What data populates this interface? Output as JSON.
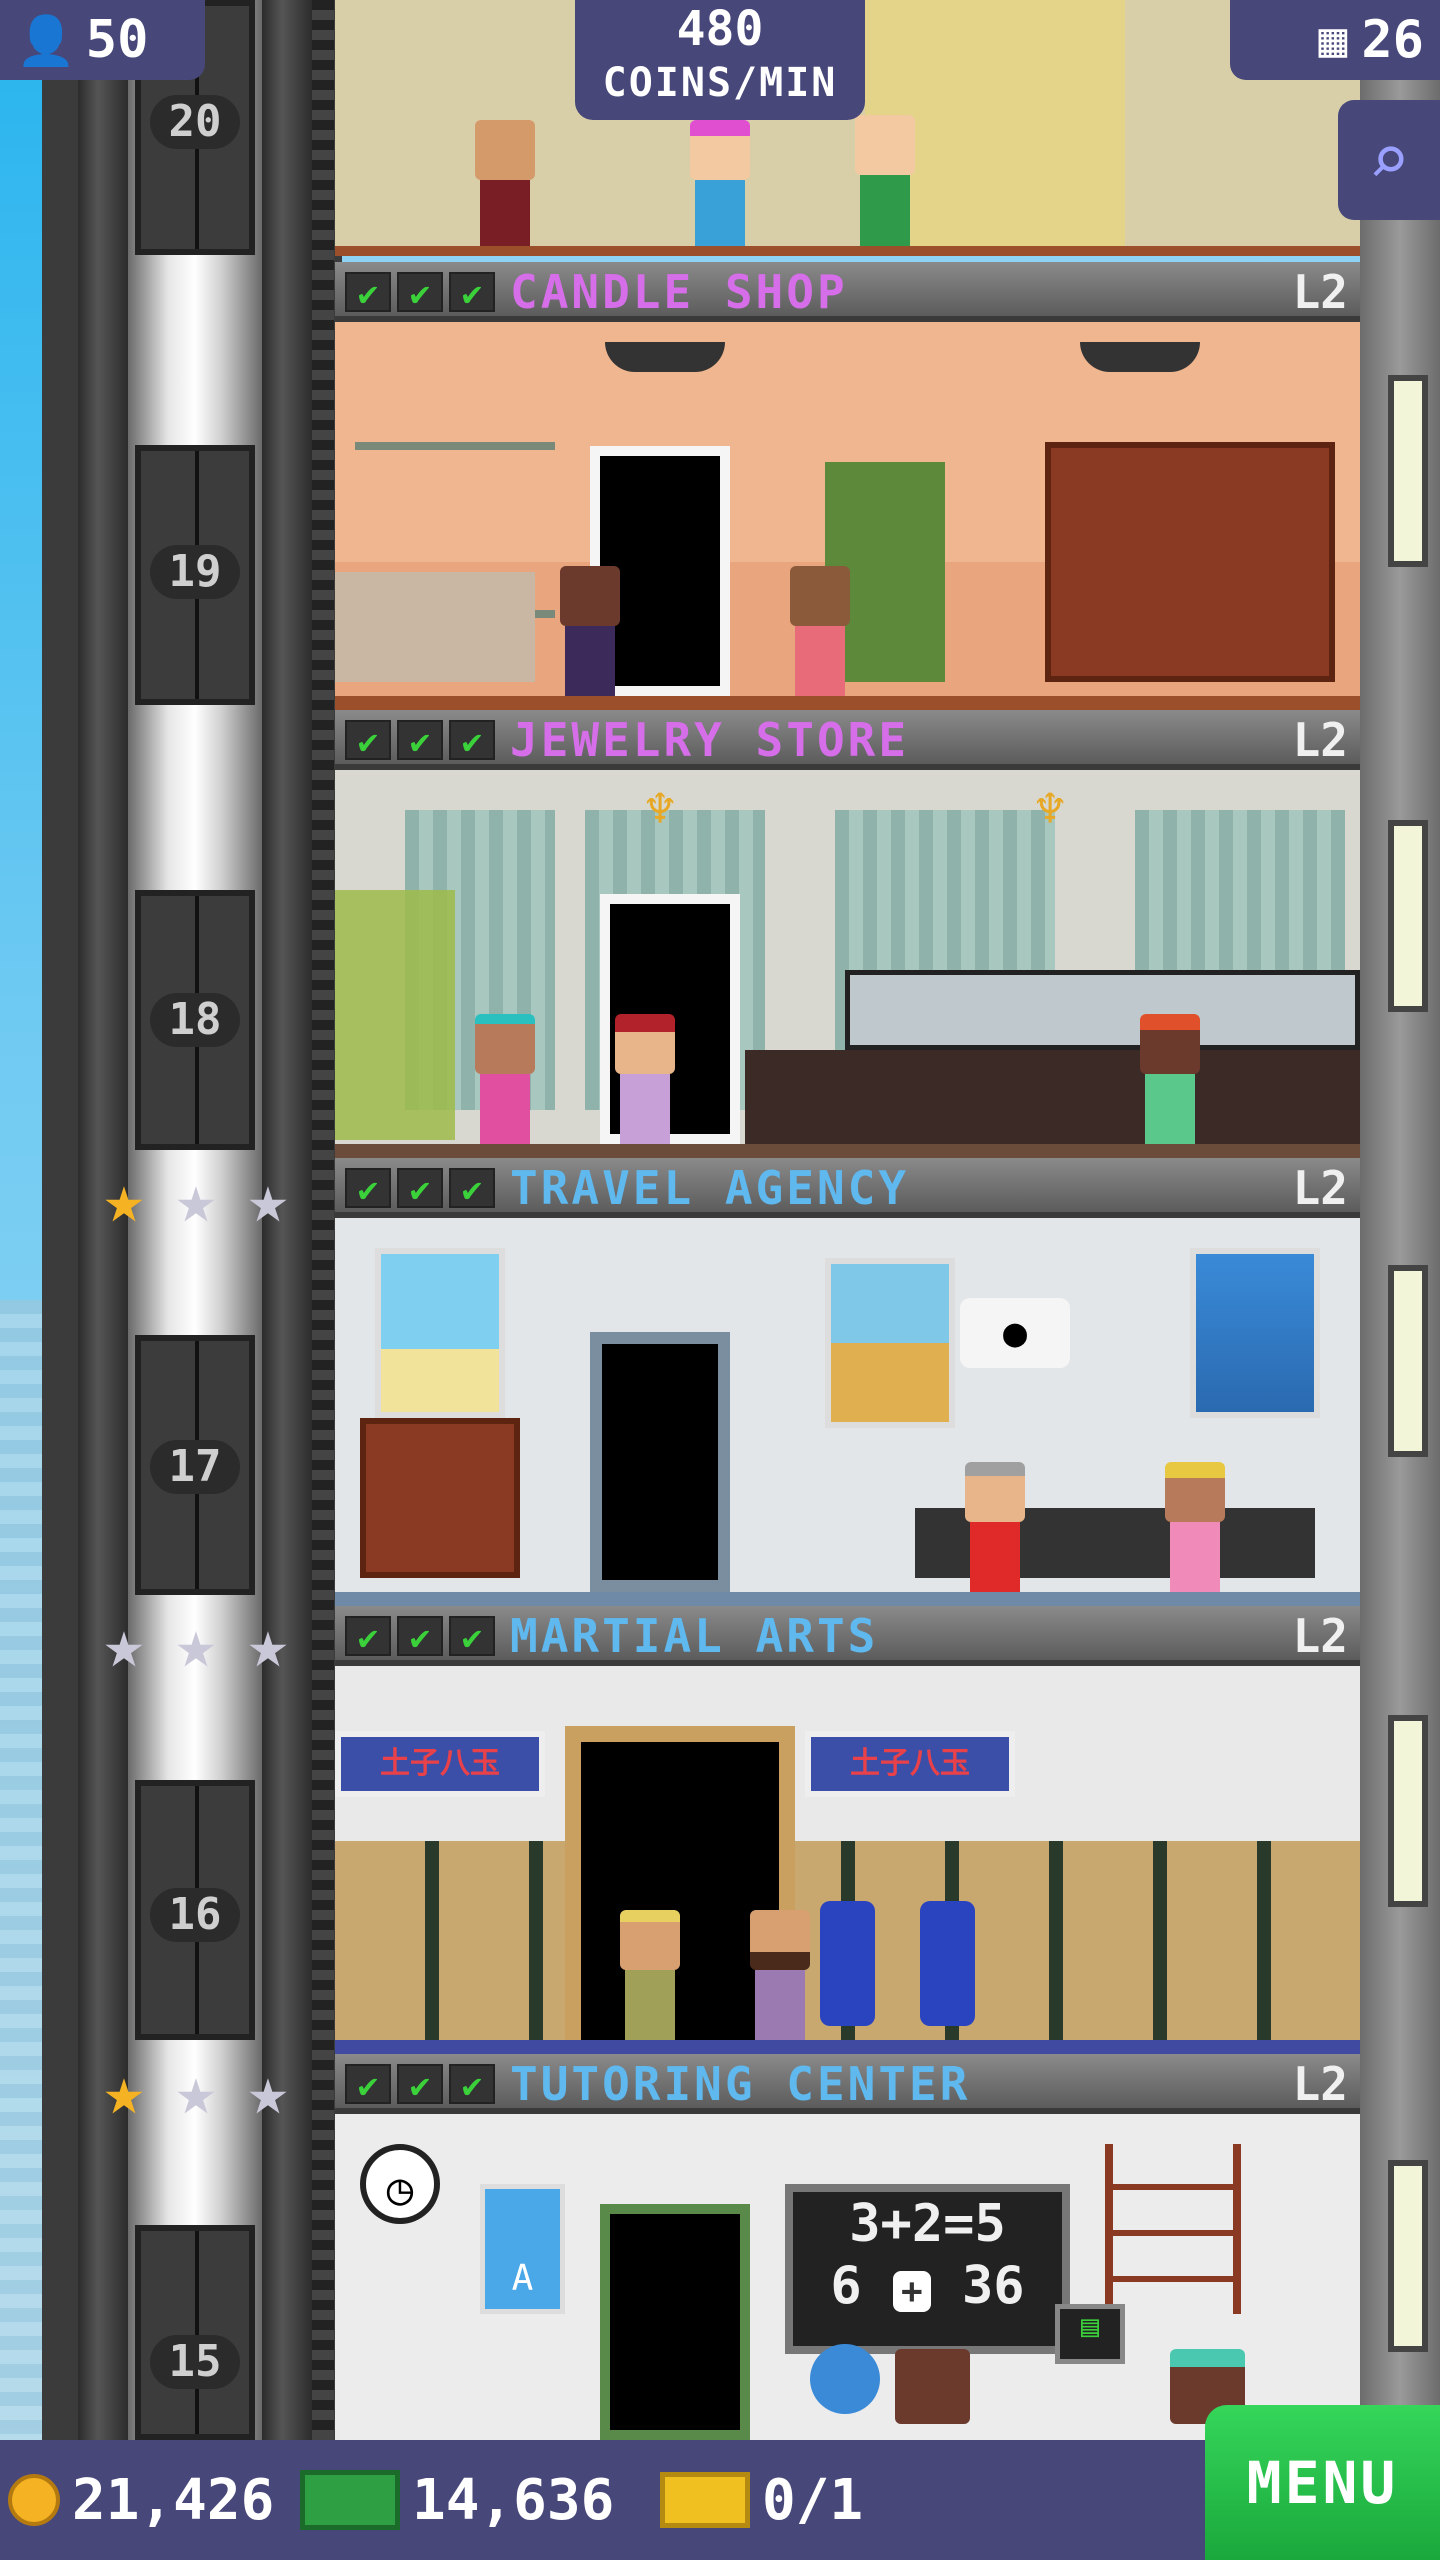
{
  "hud": {
    "population": "50",
    "coins_per_min_value": "480",
    "coins_per_min_label": "COINS/MIN",
    "floor_count": "26"
  },
  "shaft_floor_numbers": [
    "20",
    "19",
    "18",
    "17",
    "16",
    "15"
  ],
  "floors": [
    {
      "name": "CANDLE SHOP",
      "level": "L2",
      "checks": [
        "✔",
        "✔",
        "✔"
      ],
      "name_color": "#d56ee8",
      "room_bg": "#efb690",
      "floor_color": "#9b4f2a"
    },
    {
      "name": "JEWELRY STORE",
      "level": "L2",
      "checks": [
        "✔",
        "✔",
        "✔"
      ],
      "name_color": "#d56ee8",
      "room_bg": "#d8d8d0",
      "floor_color": "#6b4b3a"
    },
    {
      "name": "TRAVEL AGENCY",
      "level": "L2",
      "checks": [
        "✔",
        "✔",
        "✔"
      ],
      "name_color": "#5fb8ee",
      "room_bg": "#e2e6e8",
      "floor_color": "#6f8aa6"
    },
    {
      "name": "MARTIAL ARTS",
      "level": "L2",
      "checks": [
        "✔",
        "✔",
        "✔"
      ],
      "name_color": "#5fb8ee",
      "room_bg": "#e9e9e9",
      "floor_color": "#3f4aa0"
    },
    {
      "name": "TUTORING CENTER",
      "level": "L2",
      "checks": [
        "✔",
        "✔",
        "✔"
      ],
      "name_color": "#5fb8ee",
      "room_bg": "#ececec",
      "floor_color": "#555555"
    }
  ],
  "star_rows": [
    {
      "stars": [
        "★",
        "★",
        "★"
      ],
      "gold_count": 1
    },
    {
      "stars": [
        "★",
        "★",
        "★"
      ],
      "gold_count": 0
    },
    {
      "stars": [
        "★",
        "★",
        "★"
      ],
      "gold_count": 1
    }
  ],
  "martial_banner_text": "⼟⼦⼋⽟",
  "chalkboard": {
    "line1": "3+2=5",
    "line2": "6 ",
    "line3": "36"
  },
  "bottom": {
    "coins": "21,426",
    "bux": "14,636",
    "tickets": "0/1",
    "menu_label": "MENU"
  },
  "colors": {
    "hud_bg": "#47477a",
    "menu_green": "#1aa83c",
    "check_green": "#3ad13a",
    "gold_star": "#f5b324",
    "silver_star": "#c8c8d8"
  }
}
